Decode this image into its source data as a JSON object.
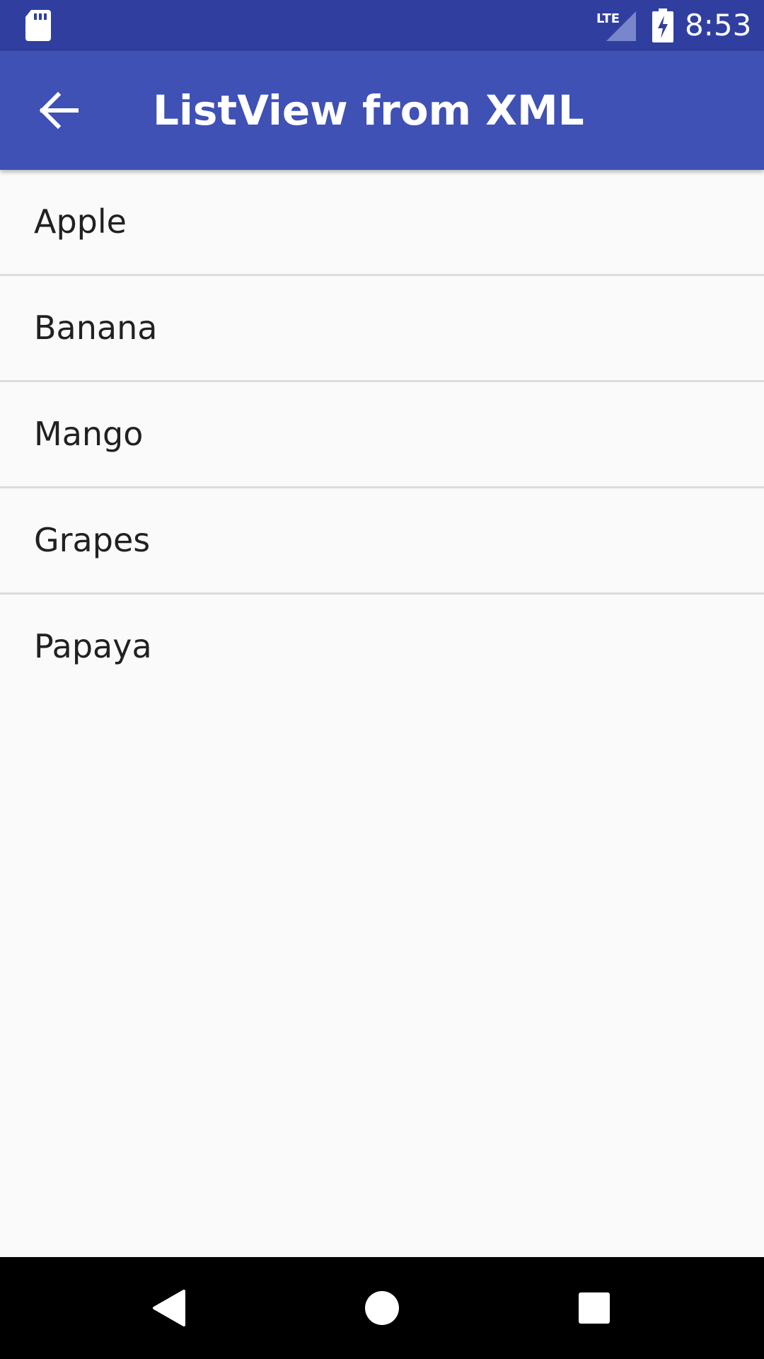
{
  "status_bar": {
    "time": "8:53",
    "network_label": "LTE",
    "icons": [
      "sd-card-icon",
      "lte-signal-icon",
      "battery-charging-icon"
    ]
  },
  "app_bar": {
    "title": "ListView from XML",
    "back_icon": "arrow-back-icon",
    "color": "#3f51b5"
  },
  "list": {
    "items": [
      {
        "label": "Apple"
      },
      {
        "label": "Banana"
      },
      {
        "label": "Mango"
      },
      {
        "label": "Grapes"
      },
      {
        "label": "Papaya"
      }
    ]
  },
  "nav_bar": {
    "buttons": [
      "back-triangle-icon",
      "home-circle-icon",
      "recents-square-icon"
    ]
  },
  "colors": {
    "status_bar": "#303f9f",
    "app_bar": "#3f51b5",
    "background": "#fafafa",
    "divider": "#dcdcdc",
    "text": "#212121"
  }
}
